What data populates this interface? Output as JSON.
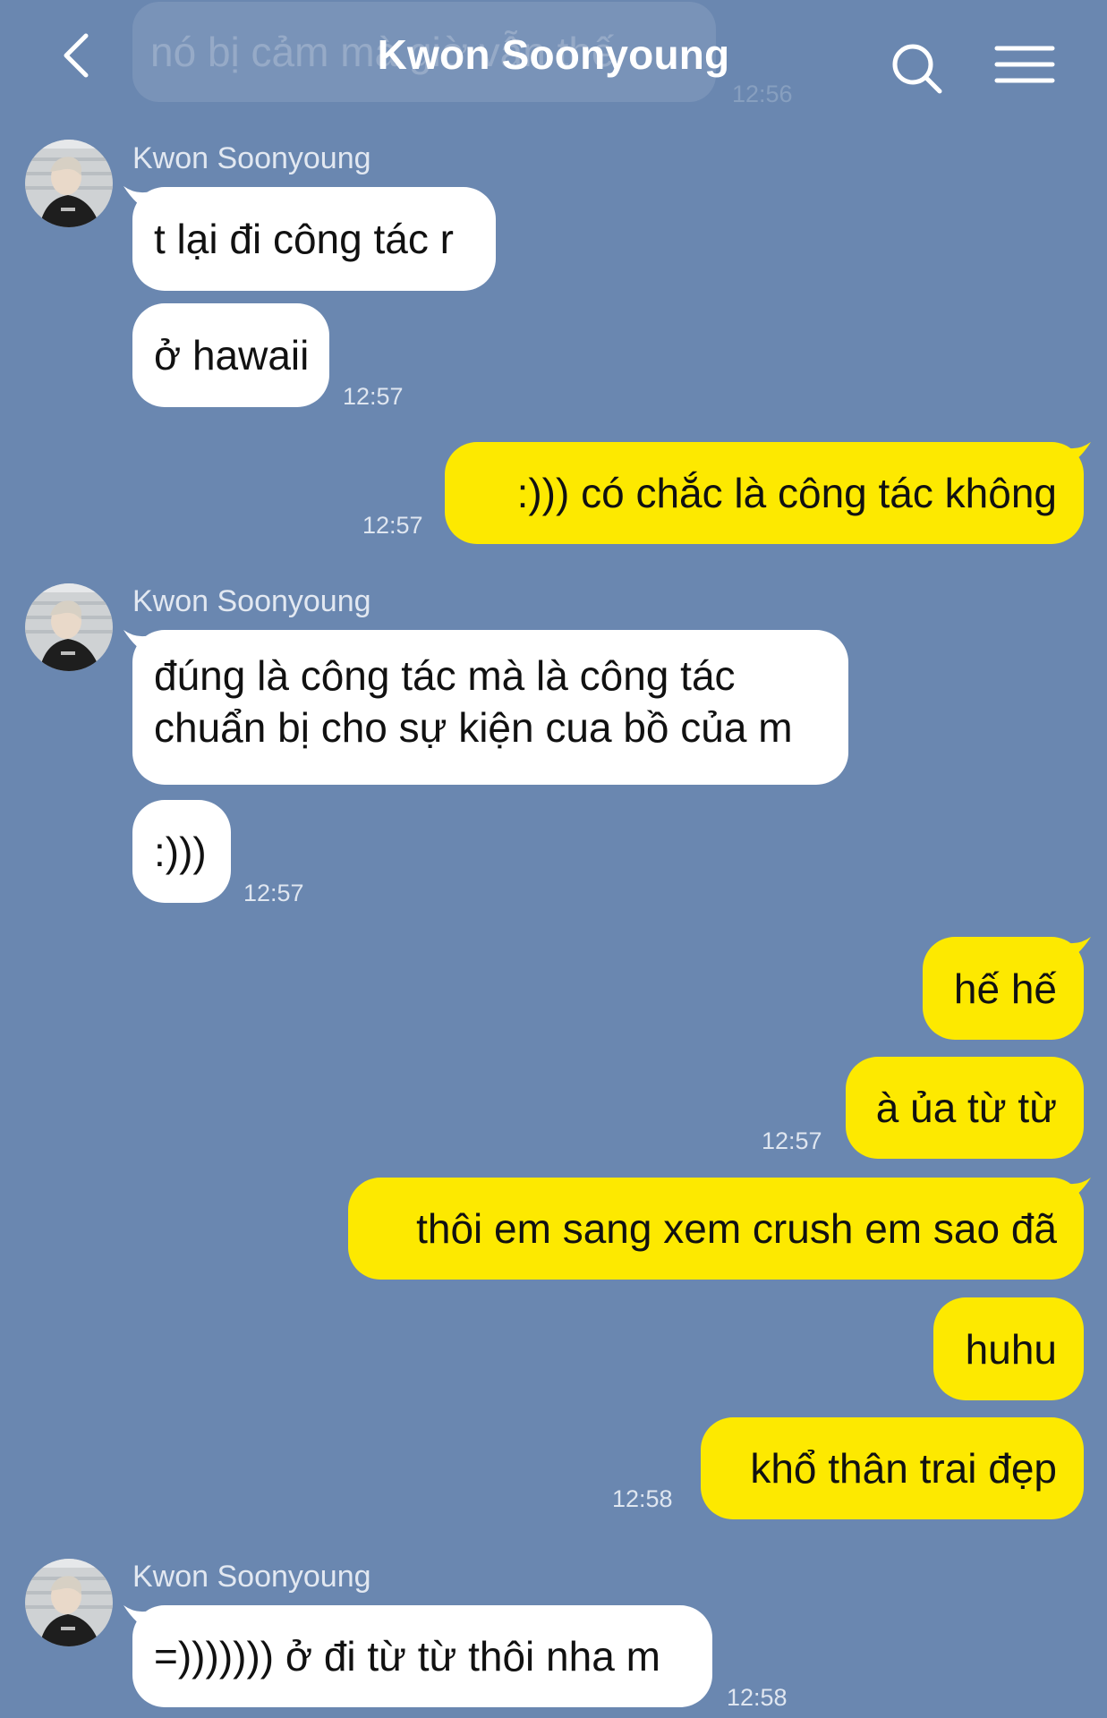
{
  "header": {
    "title": "Kwon Soonyoung",
    "back_icon": "chevron-left-icon",
    "search_icon": "search-icon",
    "menu_icon": "hamburger-menu-icon"
  },
  "colors": {
    "background": "#6a87b0",
    "incoming_bubble": "#ffffff",
    "outgoing_bubble": "#fde900",
    "text": "#111111"
  },
  "ghost_message": {
    "text": "nó bị cảm mà giờ vẫn thế",
    "time": "12:56"
  },
  "messages": [
    {
      "sender": "Kwon Soonyoung",
      "direction": "in",
      "text": "t lại đi công tác r",
      "time": ""
    },
    {
      "sender": "",
      "direction": "in",
      "text": "ở hawaii",
      "time": "12:57"
    },
    {
      "sender": "",
      "direction": "out",
      "text": ":))) có chắc là công tác không",
      "time": "12:57"
    },
    {
      "sender": "Kwon Soonyoung",
      "direction": "in",
      "lines": [
        "đúng là công tác mà là công tác",
        "chuẩn bị cho sự kiện cua bồ của m"
      ],
      "time": ""
    },
    {
      "sender": "",
      "direction": "in",
      "text": ":)))",
      "time": "12:57"
    },
    {
      "sender": "",
      "direction": "out",
      "text": "hế hế",
      "time": ""
    },
    {
      "sender": "",
      "direction": "out",
      "text": "à ủa từ từ",
      "time": "12:57"
    },
    {
      "sender": "",
      "direction": "out",
      "text": "thôi em sang xem crush em sao đã",
      "time": ""
    },
    {
      "sender": "",
      "direction": "out",
      "text": "huhu",
      "time": ""
    },
    {
      "sender": "",
      "direction": "out",
      "text": "khổ thân trai đẹp",
      "time": "12:58"
    },
    {
      "sender": "Kwon Soonyoung",
      "direction": "in",
      "text": "=))))))) ở đi từ từ thôi nha m",
      "time": "12:58"
    }
  ]
}
